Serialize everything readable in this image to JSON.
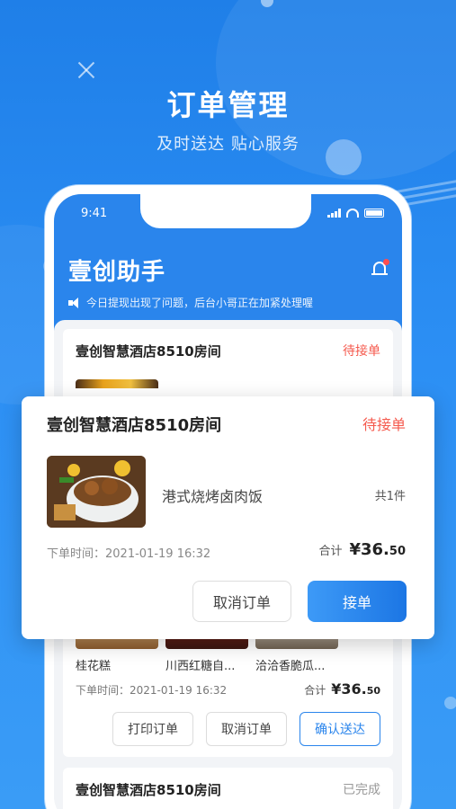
{
  "hero": {
    "title": "订单管理",
    "subtitle": "及时送达 贴心服务"
  },
  "status_bar": {
    "time": "9:41"
  },
  "app": {
    "title": "壹创助手",
    "notice": "今日提现出现了问题，后台小哥正在加紧处理喔"
  },
  "orders": [
    {
      "room": "壹创智慧酒店8510房间",
      "status": "待接单",
      "items": [
        "桂花糕",
        "川西红糖自...",
        "洽洽香脆瓜..."
      ],
      "time_label": "下单时间：",
      "time": "2021-01-19 16:32",
      "total_label": "合计",
      "price_main": "¥36.",
      "price_dec": "50",
      "buttons": [
        "打印订单",
        "取消订单",
        "确认送达"
      ]
    },
    {
      "room": "壹创智慧酒店8510房间",
      "status": "已完成"
    }
  ],
  "popup": {
    "room": "壹创智慧酒店8510房间",
    "status": "待接单",
    "dish": "港式烧烤卤肉饭",
    "count": "共1件",
    "time_label": "下单时间：",
    "time": "2021-01-19 16:32",
    "total_label": "合计",
    "price_main": "¥36.",
    "price_dec": "50",
    "cancel_label": "取消订单",
    "accept_label": "接单"
  },
  "colors": {
    "brand": "#2a85ec",
    "pending": "#f55a4e",
    "done": "#999999"
  }
}
